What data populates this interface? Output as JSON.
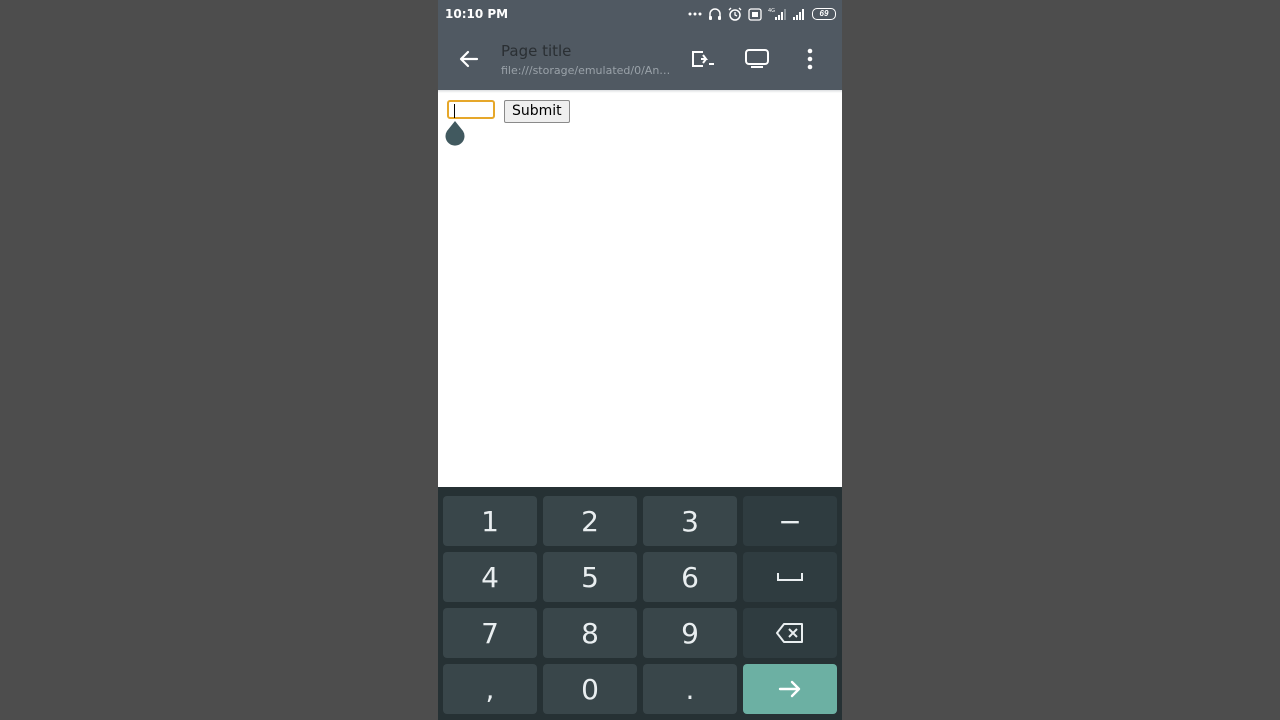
{
  "status_bar": {
    "time": "10:10 PM",
    "battery": "69",
    "icons": [
      "more-dots-icon",
      "headphones-icon",
      "alarm-icon",
      "volte-icon",
      "signal-4g-icon",
      "signal-icon",
      "battery-icon"
    ]
  },
  "toolbar": {
    "title": "Page title",
    "url": "file:///storage/emulated/0/Android/data/",
    "icons": [
      "back-arrow-icon",
      "share-icon",
      "open-in-browser-icon",
      "more-vert-icon"
    ]
  },
  "page": {
    "input_value": "",
    "submit_label": "Submit"
  },
  "keyboard": {
    "rows": [
      [
        "1",
        "2",
        "3",
        "−"
      ],
      [
        "4",
        "5",
        "6",
        "space"
      ],
      [
        "7",
        "8",
        "9",
        "backspace"
      ],
      [
        ",",
        "0",
        ".",
        "enter"
      ]
    ],
    "minus": "−",
    "accent": "#6cb0a3"
  }
}
